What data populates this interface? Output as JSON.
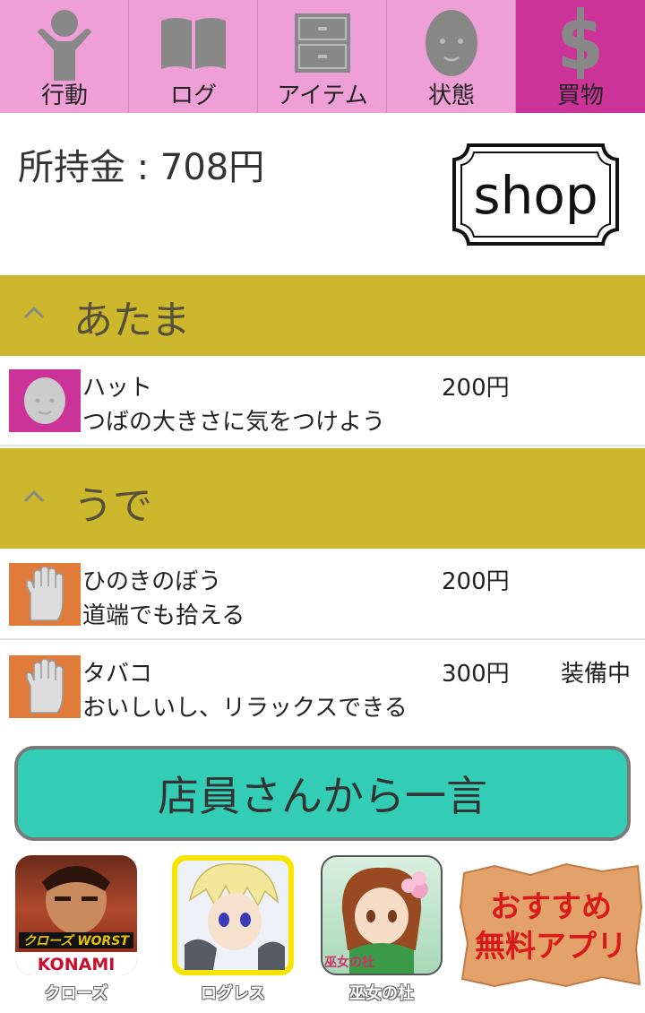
{
  "tabs": [
    {
      "label": "行動",
      "icon": "person-icon",
      "active": false
    },
    {
      "label": "ログ",
      "icon": "book-icon",
      "active": false
    },
    {
      "label": "アイテム",
      "icon": "drawer-icon",
      "active": false
    },
    {
      "label": "状態",
      "icon": "face-icon",
      "active": false
    },
    {
      "label": "買物",
      "icon": "dollar-icon",
      "active": true
    }
  ],
  "money": {
    "text": "所持金 : 708円"
  },
  "shop_sign": {
    "text": "shop"
  },
  "categories": [
    {
      "title": "あたま",
      "items": [
        {
          "name": "ハット",
          "description": "つばの大きさに気をつけよう",
          "price": "200円",
          "status": "",
          "icon": "face-icon",
          "icon_bg": "#cc3399"
        }
      ]
    },
    {
      "title": "うで",
      "items": [
        {
          "name": "ひのきのぼう",
          "description": "道端でも拾える",
          "price": "200円",
          "status": "",
          "icon": "hand-icon",
          "icon_bg": "#e07b3c"
        },
        {
          "name": "タバコ",
          "description": "おいしいし、リラックスできる",
          "price": "300円",
          "status": "装備中",
          "icon": "hand-icon",
          "icon_bg": "#e07b3c"
        }
      ]
    }
  ],
  "clerk_button": {
    "label": "店員さんから一言"
  },
  "apps": [
    {
      "caption": "クローズ",
      "brand": "KONAMI",
      "logo": "クローズ WORST"
    },
    {
      "caption": "ログレス"
    },
    {
      "caption": "巫女の杜",
      "logo": "巫女の杜"
    }
  ],
  "recommend": {
    "line1": "おすすめ",
    "line2": "無料アプリ"
  },
  "colors": {
    "tab_bg": "#ee9fd5",
    "tab_active": "#cc3399",
    "category_bar": "#cdb72d",
    "clerk_button": "#33ccb4",
    "accent_red": "#d91a1a"
  }
}
